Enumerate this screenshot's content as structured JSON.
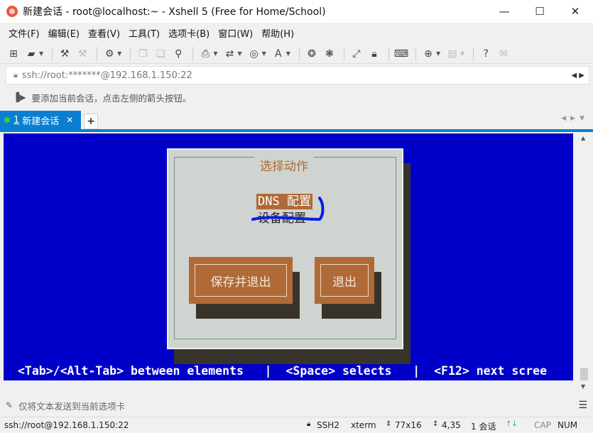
{
  "window": {
    "title": "新建会话 - root@localhost:~ - Xshell 5 (Free for Home/School)",
    "minimize": "—",
    "maximize": "☐",
    "close": "✕"
  },
  "menu": [
    "文件(F)",
    "编辑(E)",
    "查看(V)",
    "工具(T)",
    "选项卡(B)",
    "窗口(W)",
    "帮助(H)"
  ],
  "address": {
    "url": "ssh://root:*******@192.168.1.150:22"
  },
  "hint": {
    "text": "要添加当前会话，点击左侧的箭头按钮。"
  },
  "tabs": {
    "active_number": "1",
    "active_label": "新建会话",
    "close": "✕",
    "add": "+"
  },
  "terminal": {
    "dialog_title": "选择动作",
    "option1": "DNS 配置",
    "option2": "设备配置",
    "button_save": "保存并退出",
    "button_quit": "退出",
    "status_line": "<Tab>/<Alt-Tab> between elements   |  <Space> selects   |  <F12> next scree"
  },
  "input_bar": {
    "text": "仅将文本发送到当前选项卡"
  },
  "status": {
    "connection": "ssh://root@192.168.1.150:22",
    "protocol": "SSH2",
    "terminal_type": "xterm",
    "size": "77x16",
    "cursor": "4,35",
    "sessions": "1 会话",
    "cap": "CAP",
    "num": "NUM"
  },
  "colors": {
    "terminal_bg": "#0000c8",
    "tab_active": "#0a7fd1",
    "dialog_bg": "#cfd4d0",
    "accent_orange": "#b06a38"
  }
}
